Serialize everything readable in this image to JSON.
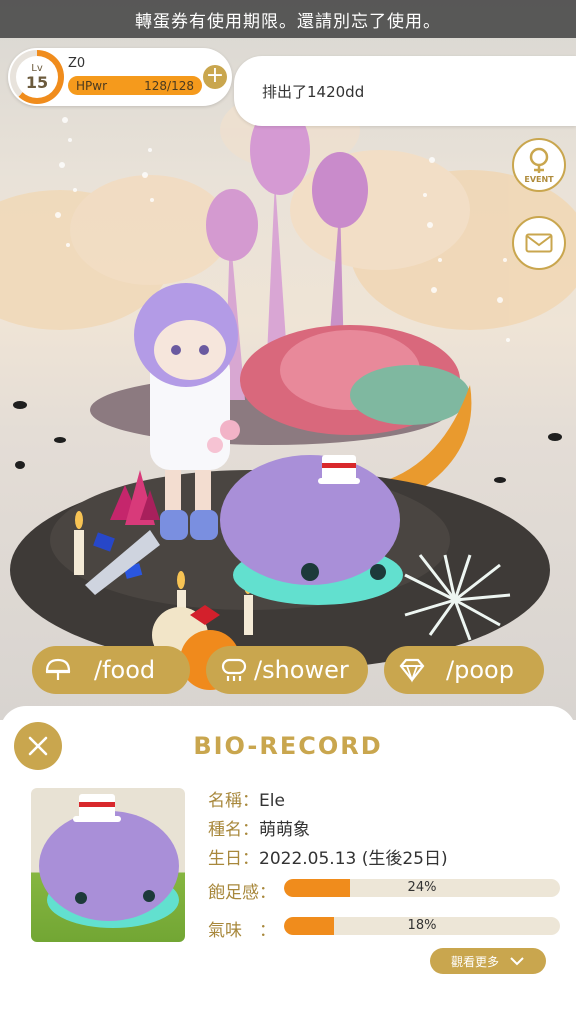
{
  "banner": {
    "text": "轉蛋券有使用期限。還請別忘了使用。"
  },
  "player": {
    "level_label": "Lv",
    "level": "15",
    "level_progress": 0.62,
    "name": "Z0",
    "hp_label": "HPwr",
    "hp_value": "128/128"
  },
  "message": {
    "text": "排出了1420dd"
  },
  "side_buttons": {
    "event_label": "EVENT"
  },
  "actions": [
    {
      "label": "/food",
      "icon": "food-icon"
    },
    {
      "label": "/shower",
      "icon": "shower-icon"
    },
    {
      "label": "/poop",
      "icon": "poop-diamond-icon"
    }
  ],
  "panel": {
    "title": "BIO-RECORD",
    "name_label": "名稱：",
    "name_value": "Ele",
    "species_label": "種名：",
    "species_value": "萌萌象",
    "birthday_label": "生日：",
    "birthday_value": "2022.05.13 (生後25日)",
    "satiety_label": "飽足感：",
    "satiety_value": "24%",
    "satiety_fraction": 0.24,
    "smell_label": "氣味　：",
    "smell_value": "18%",
    "smell_fraction": 0.18,
    "more_label": "觀看更多"
  },
  "colors": {
    "accent": "#c9a64e",
    "bar_fill": "#f08c1c",
    "pet_fur": "#a98fd8",
    "pet_body": "#62e0cf"
  }
}
